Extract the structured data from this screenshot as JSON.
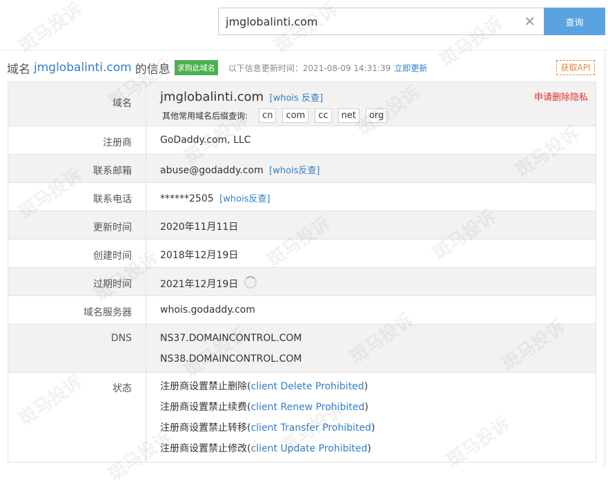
{
  "search": {
    "value": "jmglobalinti.com",
    "clear_icon": "close-icon",
    "button_label": "查询"
  },
  "header": {
    "prefix": "域名",
    "domain": "jmglobalinti.com",
    "suffix": "的信息",
    "buy_badge": "求购此域名",
    "update_label": "以下信息更新时间：2021-08-09 14:31:39",
    "update_link": "立即更新",
    "api_button": "获取API"
  },
  "rows": {
    "domain": {
      "label": "域名",
      "value": "jmglobalinti.com",
      "whois_link": "[whois 反查]",
      "suffix_prompt": "其他常用域名后缀查询:",
      "suffixes": [
        "cn",
        "com",
        "cc",
        "net",
        "org"
      ],
      "delete_privacy": "申请删除隐私"
    },
    "registrar": {
      "label": "注册商",
      "value": "GoDaddy.com, LLC"
    },
    "email": {
      "label": "联系邮箱",
      "value": "abuse@godaddy.com",
      "whois_link": "[whois反查]"
    },
    "phone": {
      "label": "联系电话",
      "value": "******2505",
      "whois_link": "[whois反查]"
    },
    "updated": {
      "label": "更新时间",
      "value": "2020年11月11日"
    },
    "created": {
      "label": "创建时间",
      "value": "2018年12月19日"
    },
    "expires": {
      "label": "过期时间",
      "value": "2021年12月19日"
    },
    "whois_server": {
      "label": "域名服务器",
      "value": "whois.godaddy.com"
    },
    "dns": {
      "label": "DNS",
      "values": [
        "NS37.DOMAINCONTROL.COM",
        "NS38.DOMAINCONTROL.COM"
      ]
    },
    "status": {
      "label": "状态",
      "items": [
        {
          "prefix": "注册商设置禁止删除(",
          "code": "client Delete Prohibited",
          "suffix": ")"
        },
        {
          "prefix": "注册商设置禁止续费(",
          "code": "client Renew Prohibited",
          "suffix": ")"
        },
        {
          "prefix": "注册商设置禁止转移(",
          "code": "client Transfer Prohibited",
          "suffix": ")"
        },
        {
          "prefix": "注册商设置禁止修改(",
          "code": "client Update Prohibited",
          "suffix": ")"
        }
      ]
    }
  },
  "watermark": "斑马投诉",
  "colors": {
    "link": "#2f7ec7",
    "search_button": "#5ba3e0",
    "badge": "#4cb050",
    "danger": "#e42b2b",
    "api": "#e8843a",
    "shaded_row": "#f2f2f2"
  }
}
